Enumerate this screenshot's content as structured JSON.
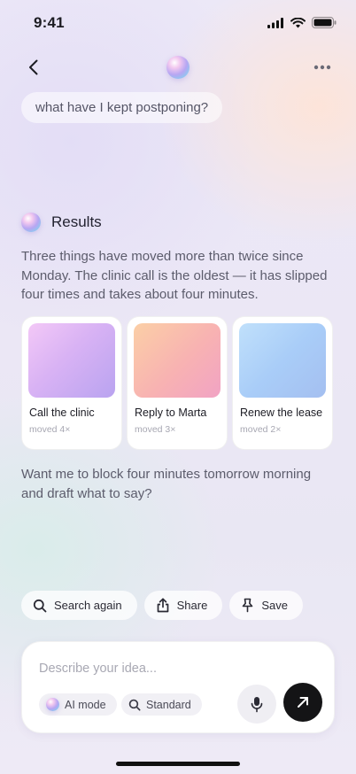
{
  "status_bar": {
    "time": "9:41",
    "icons": [
      "cellular-signal-icon",
      "wifi-icon",
      "battery-icon"
    ]
  },
  "nav": {
    "back_icon": "chevron-left-icon",
    "more_icon": "ellipsis-icon"
  },
  "query": {
    "text": "what have I kept postponing?"
  },
  "results": {
    "title": "Results",
    "summary": "Three things have moved more than twice since Monday. The clinic call is the oldest — it has slipped four times and takes about four minutes.",
    "cards": [
      {
        "title": "Call the clinic",
        "subtitle": "moved 4×"
      },
      {
        "title": "Reply to Marta",
        "subtitle": "moved 3×"
      },
      {
        "title": "Renew the lease",
        "subtitle": "moved 2×"
      }
    ],
    "followup": "Want me to block four minutes tomorrow morning and draft what to say?"
  },
  "actions": [
    {
      "label": "Search again",
      "icon": "search-icon"
    },
    {
      "label": "Share",
      "icon": "share-icon"
    },
    {
      "label": "Save",
      "icon": "pin-icon"
    }
  ],
  "composer": {
    "placeholder": "Describe your idea...",
    "ai_mode_label": "AI mode",
    "standard_label": "Standard",
    "mic_icon": "microphone-icon",
    "send_icon": "arrow-up-right-icon"
  },
  "colors": {
    "send_button": "#141416",
    "background": "#ebe7f5",
    "card_background": "#ffffff"
  }
}
